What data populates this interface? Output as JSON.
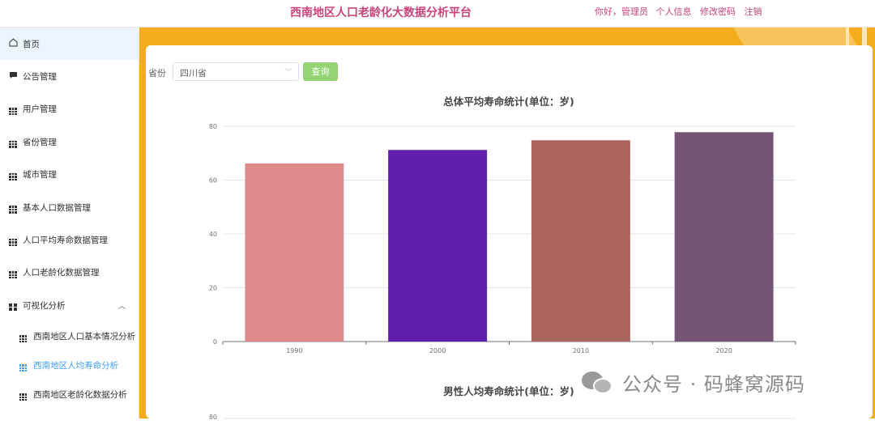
{
  "header": {
    "title": "西南地区人口老龄化大数据分析平台",
    "greeting": "你好，管理员",
    "links": [
      "个人信息",
      "修改密码",
      "注销"
    ]
  },
  "sidebar": {
    "items": [
      {
        "label": "首页",
        "icon": "home-icon"
      },
      {
        "label": "公告管理",
        "icon": "message-icon"
      },
      {
        "label": "用户管理",
        "icon": "grid-icon"
      },
      {
        "label": "省份管理",
        "icon": "grid-icon"
      },
      {
        "label": "城市管理",
        "icon": "grid-icon"
      },
      {
        "label": "基本人口数据管理",
        "icon": "grid-icon"
      },
      {
        "label": "人口平均寿命数据管理",
        "icon": "grid-icon"
      },
      {
        "label": "人口老龄化数据管理",
        "icon": "grid-icon"
      },
      {
        "label": "可视化分析",
        "icon": "menu-icon"
      }
    ],
    "sub_items": [
      {
        "label": "西南地区人口基本情况分析"
      },
      {
        "label": "西南地区人均寿命分析"
      },
      {
        "label": "西南地区老龄化数据分析"
      }
    ],
    "accent": "#409eff"
  },
  "filter": {
    "label": "省份",
    "selected": "四川省",
    "query_label": "查询"
  },
  "chart_data": [
    {
      "type": "bar",
      "title": "总体平均寿命统计(单位：岁)",
      "categories": [
        "1990",
        "2000",
        "2010",
        "2020"
      ],
      "values": [
        66.2,
        71.2,
        74.8,
        77.8
      ],
      "colors": [
        "#dd8a8b",
        "#6020ad",
        "#ac655c",
        "#755575"
      ],
      "ylim": [
        0,
        80
      ],
      "yticks": [
        0,
        20,
        40,
        60,
        80
      ],
      "grid": true
    },
    {
      "type": "bar",
      "title": "男性人均寿命统计(单位：岁)",
      "yticks": [
        80
      ]
    }
  ],
  "watermark": "公众号 · 码蜂窝源码"
}
